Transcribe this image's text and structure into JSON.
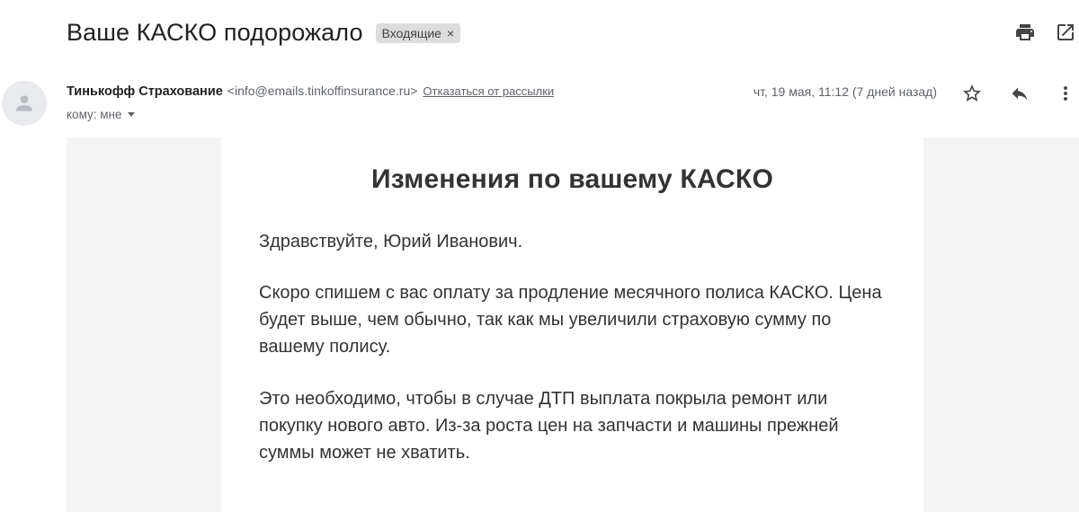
{
  "email": {
    "subject": "Ваше КАСКО подорожало",
    "label": "Входящие",
    "label_remove": "×",
    "sender_name": "Тинькофф Страхование",
    "sender_email": "<info@emails.tinkoffinsurance.ru>",
    "unsubscribe": "Отказаться от рассылки",
    "to": "кому: мне",
    "date": "чт, 19 мая, 11:12 (7 дней назад)"
  },
  "icons": {
    "print": "print-icon",
    "open_new_window": "open-in-new-window-icon",
    "avatar": "person-icon",
    "star": "star-icon",
    "reply": "reply-icon",
    "more": "more-vert-icon"
  },
  "content": {
    "heading": "Изменения по вашему КАСКО",
    "greeting": "Здравствуйте, Юрий Иванович.",
    "paragraph1": "Скоро спишем с вас оплату за продление месячного полиса КАСКО. Цена будет выше, чем обычно, так как мы увеличили страховую сумму по вашему полису.",
    "paragraph2": "Это необходимо, чтобы в случае ДТП выплата покрыла ремонт или покупку нового авто. Из-за роста цен на запчасти и машины прежней суммы может не хватить."
  }
}
